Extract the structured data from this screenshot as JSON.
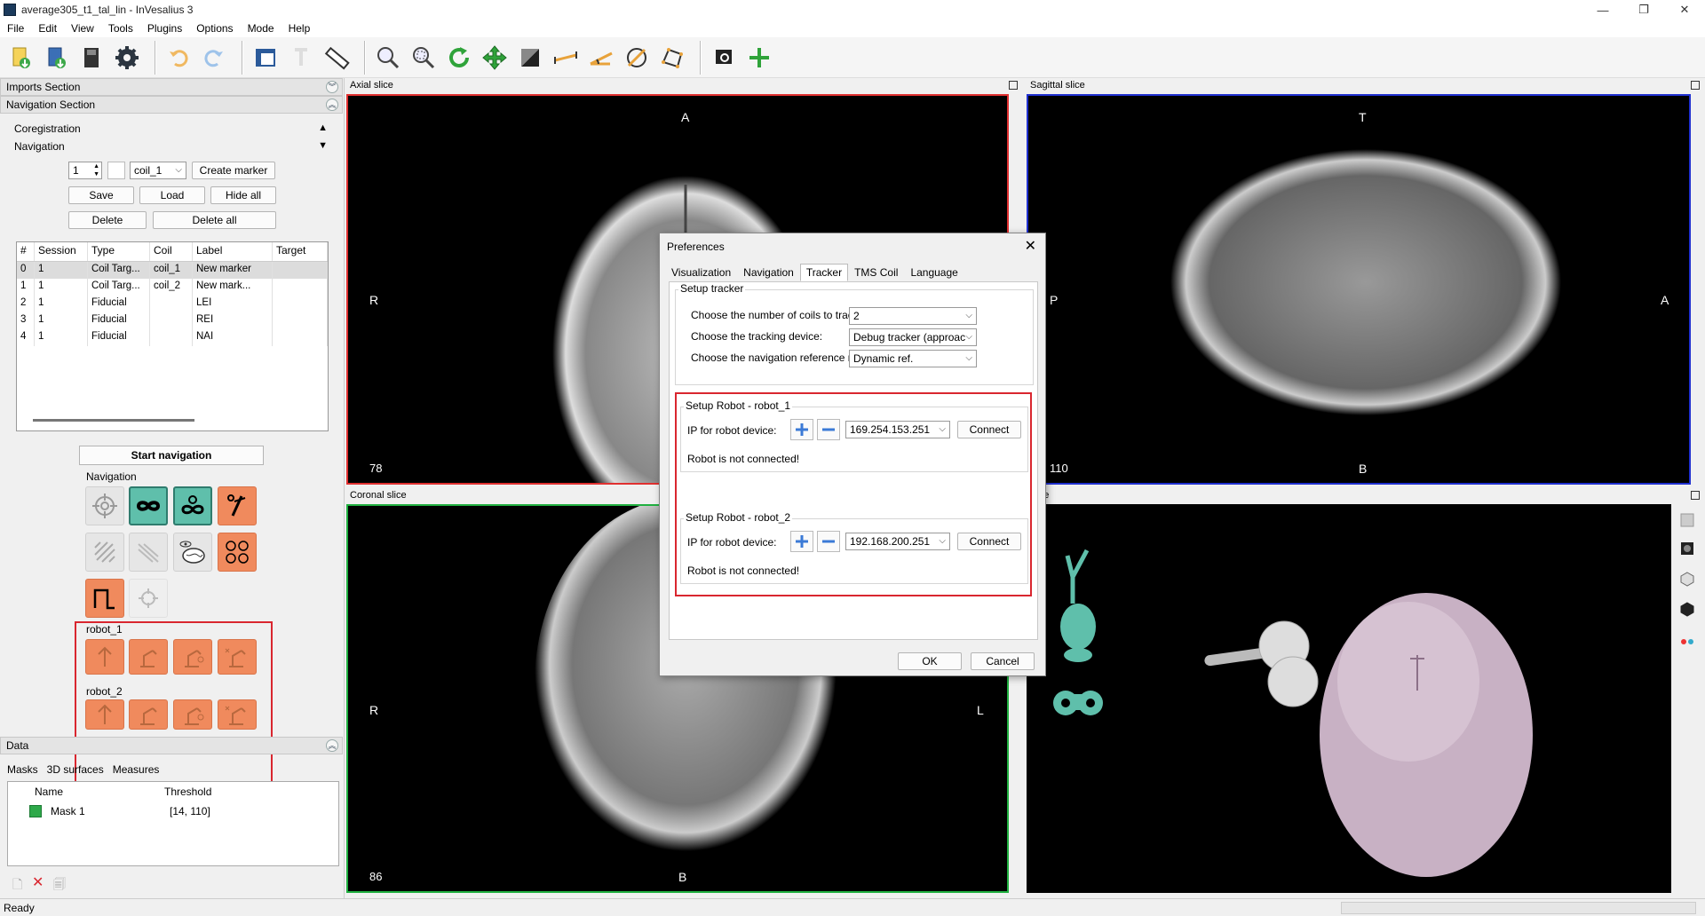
{
  "window": {
    "title": "average305_t1_tal_lin - InVesalius 3",
    "min": "—",
    "max": "❐",
    "close": "✕"
  },
  "menu": [
    "File",
    "Edit",
    "View",
    "Tools",
    "Plugins",
    "Options",
    "Mode",
    "Help"
  ],
  "toolbar": {
    "icons": [
      "import-icon",
      "open-icon",
      "save-icon",
      "settings-icon",
      "undo-icon",
      "redo-icon",
      "layout-icon",
      "text-icon",
      "ruler-icon",
      "zoom-icon",
      "zoom-region-icon",
      "rotate-icon",
      "pan-icon",
      "contrast-icon",
      "measure-linear-icon",
      "measure-angle-icon",
      "measure-circle-icon",
      "measure-polygon-icon",
      "screenshot-icon",
      "add-icon"
    ]
  },
  "left": {
    "imports_section": "Imports Section",
    "navigation_section": "Navigation Section",
    "coregistration": "Coregistration",
    "navigation": "Navigation",
    "marker_count": "1",
    "coil_select": "coil_1",
    "create_marker": "Create marker",
    "save": "Save",
    "load": "Load",
    "hide_all": "Hide all",
    "delete": "Delete",
    "delete_all": "Delete all",
    "table": {
      "headers": [
        "#",
        "Session",
        "Type",
        "Coil",
        "Label",
        "Target"
      ],
      "rows": [
        [
          "0",
          "1",
          "Coil Targ...",
          "coil_1",
          "New marker",
          ""
        ],
        [
          "1",
          "1",
          "Coil Targ...",
          "coil_2",
          "New mark...",
          ""
        ],
        [
          "2",
          "1",
          "Fiducial",
          "",
          "LEI",
          ""
        ],
        [
          "3",
          "1",
          "Fiducial",
          "",
          "REI",
          ""
        ],
        [
          "4",
          "1",
          "Fiducial",
          "",
          "NAI",
          ""
        ]
      ]
    },
    "start_navigation": "Start navigation",
    "nav_group": "Navigation",
    "robot1": "robot_1",
    "robot2": "robot_2",
    "data_section": "Data",
    "data_tabs": [
      "Masks",
      "3D surfaces",
      "Measures"
    ],
    "mask_headers": [
      "Name",
      "Threshold"
    ],
    "mask_row": {
      "name": "Mask 1",
      "threshold": "[14, 110]",
      "color": "#2ea94a"
    }
  },
  "viewports": {
    "axial": {
      "title": "Axial slice",
      "top": "A",
      "left": "R",
      "slice": "78"
    },
    "sagittal": {
      "title": "Sagittal slice",
      "top": "T",
      "left": "P",
      "right": "A",
      "bottom": "B",
      "slice": "110"
    },
    "coronal": {
      "title": "Coronal slice",
      "left": "R",
      "right": "L",
      "bottom": "B",
      "slice": "86"
    },
    "volume": {
      "title": "ume"
    }
  },
  "dialog": {
    "title": "Preferences",
    "tabs": [
      "Visualization",
      "Navigation",
      "Tracker",
      "TMS Coil",
      "Language"
    ],
    "active_tab": "Tracker",
    "setup_tracker": "Setup tracker",
    "num_coils_label": "Choose the number of coils to track:",
    "num_coils_value": "2",
    "device_label": "Choose the tracking device:",
    "device_value": "Debug tracker (approac",
    "ref_mode_label": "Choose the navigation reference mode:",
    "ref_mode_value": "Dynamic ref.",
    "robot1": {
      "title": "Setup Robot - robot_1",
      "ip_label": "IP for robot device:",
      "ip": "169.254.153.251",
      "connect": "Connect",
      "status": "Robot is not connected!"
    },
    "robot2": {
      "title": "Setup Robot - robot_2",
      "ip_label": "IP for robot device:",
      "ip": "192.168.200.251",
      "connect": "Connect",
      "status": "Robot is not connected!"
    },
    "ok": "OK",
    "cancel": "Cancel"
  },
  "status": "Ready",
  "colors": {
    "highlight": "#d9262f",
    "teal": "#5fbfab",
    "orange": "#f08a5d",
    "axial_border": "#e03030",
    "sagittal_border": "#2030d0",
    "coronal_border": "#20b040"
  }
}
